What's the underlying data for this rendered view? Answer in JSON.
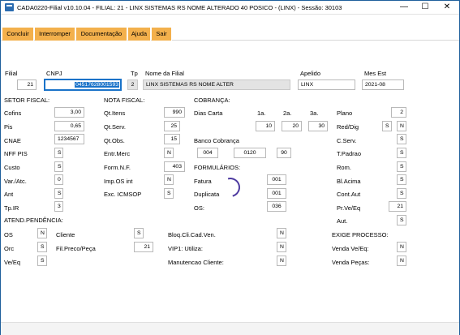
{
  "window": {
    "title": "CADA0220-Filial v10.10.04  - FILIAL: 21 - LINX SISTEMAS RS NOME ALTERADO 40 POSICO - (LINX) - Sessão: 30103",
    "min": "—",
    "max": "☐",
    "close": "✕"
  },
  "toolbar": {
    "concluir": "Concluir",
    "interromper": "Interromper",
    "documentacao": "Documentação",
    "ajuda": "Ajuda",
    "sair": "Sair"
  },
  "header": {
    "filial_label": "Filial",
    "filial": "21",
    "cnpj_label": "CNPJ",
    "cnpj": "04517628001593",
    "tp_label": "Tp",
    "tp": "2",
    "nome_label": "Nome da Filial",
    "nome": "LINX SISTEMAS RS NOME ALTER",
    "apelido_label": "Apelido",
    "apelido": "LINX",
    "mes_label": "Mes Est",
    "mes": "2021-08"
  },
  "setor": {
    "title": "SETOR FISCAL:",
    "cofins_label": "Cofins",
    "cofins": "3,00",
    "pis_label": "Pis",
    "pis": "0,65",
    "cnae_label": "CNAE",
    "cnae": "1234567",
    "nff_label": "NFF PIS",
    "nff": "S",
    "custo_label": "Custo",
    "custo": "S",
    "var_label": "Var./Atc.",
    "var": "0",
    "ant_label": "Ant",
    "ant": "S",
    "tpir_label": "Tp.IR",
    "tpir": "3"
  },
  "nota": {
    "title": "NOTA FISCAL:",
    "qtitens_label": "Qt.Itens",
    "qtitens": "990",
    "qtserv_label": "Qt.Serv.",
    "qtserv": "25",
    "qtobs_label": "Qt.Obs.",
    "qtobs": "15",
    "entr_label": "Entr.Merc",
    "entr": "N",
    "form_label": "Form.N.F.",
    "form": "403",
    "imp_label": "Imp.OS int",
    "imp": "N",
    "exc_label": "Exc. ICMSOP",
    "exc": "S"
  },
  "cobranca": {
    "title": "COBRANÇA:",
    "dias_label": "Dias Carta",
    "h1": "1a.",
    "h2": "2a.",
    "h3": "3a.",
    "d1": "10",
    "d2": "20",
    "d3": "30",
    "banco_label": "Banco Cobrança",
    "b1": "004",
    "b2": "0120",
    "b3": "90"
  },
  "formularios": {
    "title": "FORMULÁRIOS:",
    "fatura_label": "Fatura",
    "fatura": "001",
    "duplicata_label": "Duplicata",
    "duplicata": "001",
    "os_label": "OS:",
    "os": "036"
  },
  "right": {
    "plano_label": "Plano",
    "plano": "2",
    "red_label": "Red/Dig",
    "red1": "S",
    "red2": "N",
    "cserv_label": "C.Serv.",
    "cserv": "S",
    "tpadrao_label": "T.Padrao",
    "tpadrao": "S",
    "rom_label": "Rom.",
    "rom": "S",
    "blacima_label": "Bl.Acima",
    "blacima": "S",
    "contaut_label": "Cont.Aut",
    "contaut": "S",
    "prve_label": "Pr.Ve/Eq",
    "prve": "21",
    "aut_label": "Aut.",
    "aut": "S"
  },
  "atend": {
    "title": "ATEND.PENDÊNCIA:",
    "os_label": "OS",
    "os": "N",
    "orc_label": "Orc",
    "orc": "S",
    "veeq_label": "Ve/Eq",
    "veeq": "S",
    "cliente_label": "Cliente",
    "cliente": "S",
    "filpreco_label": "Fil.Preco/Peça",
    "filpreco": "21"
  },
  "bloq": {
    "bloq_label": "Bloq.Cli.Cad.Ven.",
    "bloq": "N",
    "vip_label": "VIP1: Utiliza:",
    "vip": "N",
    "manut_label": "Manutencao Cliente:",
    "manut": "N"
  },
  "exige": {
    "title": "EXIGE PROCESSO:",
    "venda_label": "Venda Ve/Eq:",
    "venda": "N",
    "pecas_label": "Venda Peças:",
    "pecas": "N"
  }
}
